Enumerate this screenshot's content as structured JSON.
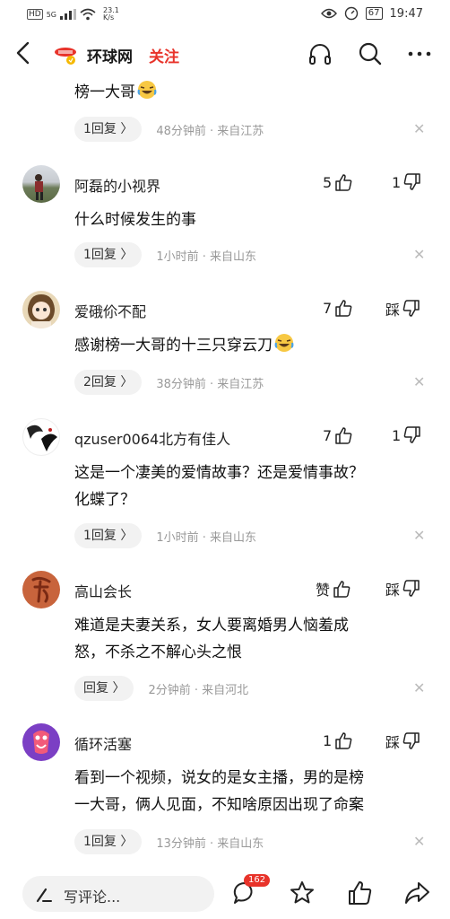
{
  "status_bar": {
    "network": "HD",
    "signal": "5G",
    "speed_value": "23.1",
    "speed_unit": "K/s",
    "battery": "67",
    "time": "19:47"
  },
  "header": {
    "site_name": "环球网",
    "follow_label": "关注"
  },
  "comments": [
    {
      "text": "榜一大哥",
      "reply_label": "1回复 〉",
      "meta": "48分钟前 · 来自江苏"
    },
    {
      "username": "阿磊的小视界",
      "likes": "5",
      "dislikes": "1",
      "text": "什么时候发生的事",
      "reply_label": "1回复 〉",
      "meta": "1小时前 · 来自山东"
    },
    {
      "username": "爱硪伱不配",
      "likes": "7",
      "dislikes": "踩",
      "text": "感谢榜一大哥的十三只穿云刀",
      "reply_label": "2回复 〉",
      "meta": "38分钟前 · 来自江苏"
    },
    {
      "username": "qzuser0064北方有佳人",
      "likes": "7",
      "dislikes": "1",
      "text_line1": "这是一个凄美的爱情故事？还是爱情事故？",
      "text_line2": "化蝶了？",
      "reply_label": "1回复 〉",
      "meta": "1小时前 · 来自山东"
    },
    {
      "username": "高山会长",
      "likes": "赞",
      "dislikes": "踩",
      "text_line1": "难道是夫妻关系，女人要离婚男人恼羞成",
      "text_line2": "怒，不杀之不解心头之恨",
      "reply_label": "回复 〉",
      "meta": "2分钟前 · 来自河北"
    },
    {
      "username": "循环活塞",
      "likes": "1",
      "dislikes": "踩",
      "text_line1": "看到一个视频，说女的是女主播，男的是榜",
      "text_line2": "一大哥，俩人见面，不知啥原因出现了命案",
      "reply_label": "1回复 〉",
      "meta": "13分钟前 · 来自山东"
    }
  ],
  "bottom_bar": {
    "input_placeholder": "写评论...",
    "comment_count": "162"
  },
  "colors": {
    "accent": "#e8332a",
    "meta_text": "#999999",
    "reply_bg": "#f2f2f2"
  }
}
